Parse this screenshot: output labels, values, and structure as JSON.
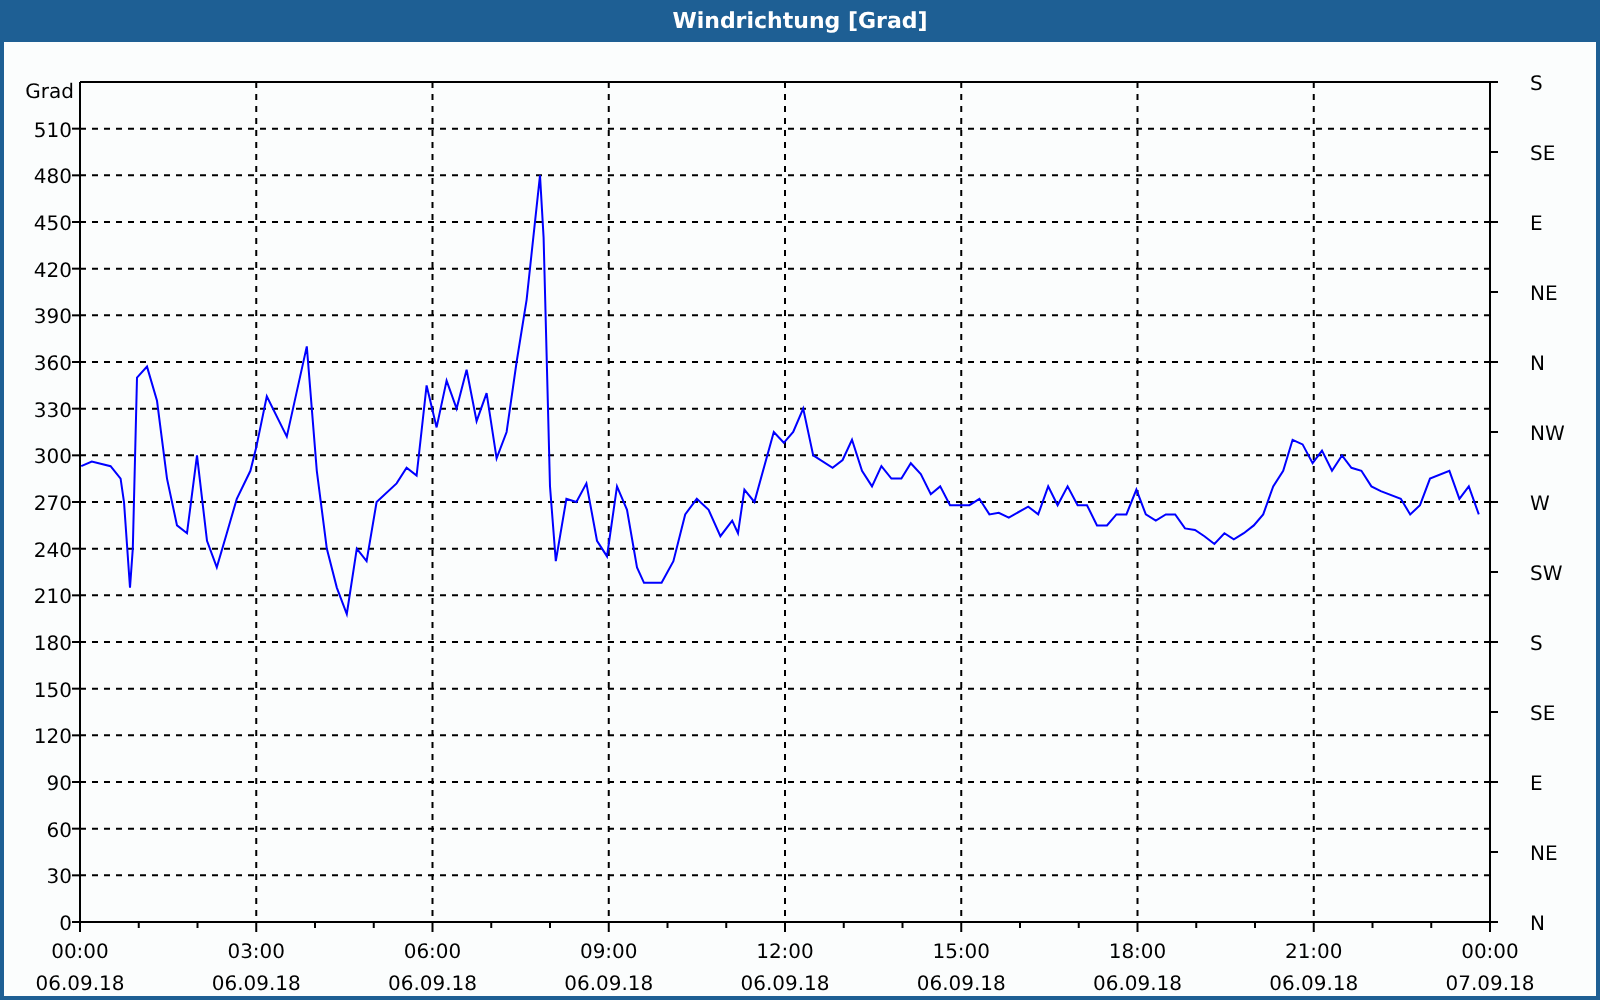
{
  "window": {
    "title": "Windrichtung [Grad]"
  },
  "chart": {
    "x_dates": [
      "06.09.18",
      "06.09.18",
      "06.09.18",
      "06.09.18",
      "06.09.18",
      "06.09.18",
      "06.09.18",
      "06.09.18",
      "07.09.18"
    ],
    "right_axis_labels": [
      "S",
      "SE",
      "E",
      "NE",
      "N",
      "NW",
      "W",
      "SW",
      "S",
      "SE",
      "E",
      "NE",
      "N"
    ],
    "chart_data": {
      "type": "line",
      "grid": true,
      "ylabel": "Grad",
      "xlim": [
        0,
        24
      ],
      "ylim": [
        0,
        540
      ],
      "yticks": [
        0,
        30,
        60,
        90,
        120,
        150,
        180,
        210,
        240,
        270,
        300,
        330,
        360,
        390,
        420,
        450,
        480,
        510
      ],
      "xticks": [
        {
          "value": 0,
          "label": "00:00"
        },
        {
          "value": 3,
          "label": "03:00"
        },
        {
          "value": 6,
          "label": "06:00"
        },
        {
          "value": 9,
          "label": "09:00"
        },
        {
          "value": 12,
          "label": "12:00"
        },
        {
          "value": 15,
          "label": "15:00"
        },
        {
          "value": 18,
          "label": "18:00"
        },
        {
          "value": 21,
          "label": "21:00"
        },
        {
          "value": 24,
          "label": "00:00"
        }
      ],
      "x": [
        0.02,
        0.2,
        0.52,
        0.69,
        0.75,
        0.85,
        0.9,
        0.97,
        1.14,
        1.31,
        1.48,
        1.65,
        1.82,
        1.99,
        2.16,
        2.33,
        2.5,
        2.67,
        2.9,
        3.0,
        3.18,
        3.52,
        3.86,
        4.03,
        4.2,
        4.37,
        4.54,
        4.71,
        4.88,
        5.05,
        5.39,
        5.56,
        5.73,
        5.9,
        6.07,
        6.24,
        6.41,
        6.58,
        6.75,
        6.92,
        7.09,
        7.26,
        7.43,
        7.6,
        7.83,
        7.89,
        8.0,
        8.1,
        8.28,
        8.45,
        8.62,
        8.8,
        8.97,
        9.14,
        9.31,
        9.48,
        9.6,
        9.9,
        10.1,
        10.3,
        10.5,
        10.7,
        10.9,
        11.1,
        11.2,
        11.31,
        11.48,
        11.81,
        11.98,
        12.14,
        12.31,
        12.48,
        12.81,
        12.98,
        13.14,
        13.31,
        13.48,
        13.64,
        13.81,
        13.98,
        14.14,
        14.31,
        14.48,
        14.64,
        14.81,
        15.14,
        15.31,
        15.48,
        15.64,
        15.81,
        16.14,
        16.31,
        16.48,
        16.64,
        16.81,
        16.98,
        17.14,
        17.31,
        17.48,
        17.64,
        17.81,
        17.98,
        18.14,
        18.31,
        18.48,
        18.64,
        18.81,
        18.98,
        19.14,
        19.31,
        19.48,
        19.64,
        19.81,
        19.98,
        20.14,
        20.31,
        20.48,
        20.64,
        20.81,
        20.98,
        21.14,
        21.31,
        21.48,
        21.64,
        21.81,
        21.98,
        22.14,
        22.48,
        22.64,
        22.81,
        22.98,
        23.31,
        23.48,
        23.64,
        23.81
      ],
      "series": [
        {
          "color": "#0000ff",
          "values": [
            293,
            296,
            293,
            285,
            270,
            215,
            240,
            350,
            357,
            335,
            285,
            255,
            250,
            300,
            245,
            228,
            250,
            272,
            290,
            305,
            338,
            312,
            370,
            290,
            240,
            215,
            198,
            240,
            232,
            270,
            282,
            292,
            287,
            345,
            318,
            348,
            330,
            355,
            322,
            340,
            298,
            315,
            360,
            400,
            480,
            440,
            280,
            232,
            272,
            270,
            282,
            245,
            235,
            280,
            265,
            228,
            218,
            218,
            232,
            262,
            272,
            265,
            248,
            258,
            250,
            278,
            270,
            315,
            308,
            315,
            330,
            300,
            292,
            297,
            310,
            290,
            280,
            293,
            285,
            285,
            295,
            288,
            275,
            280,
            268,
            268,
            272,
            262,
            263,
            260,
            267,
            262,
            280,
            268,
            280,
            268,
            268,
            255,
            255,
            262,
            262,
            278,
            262,
            258,
            262,
            262,
            253,
            252,
            248,
            243,
            250,
            246,
            250,
            255,
            262,
            280,
            290,
            310,
            307,
            295,
            303,
            290,
            300,
            292,
            290,
            280,
            277,
            272,
            262,
            268,
            285,
            290,
            272,
            280,
            262
          ]
        }
      ]
    }
  }
}
